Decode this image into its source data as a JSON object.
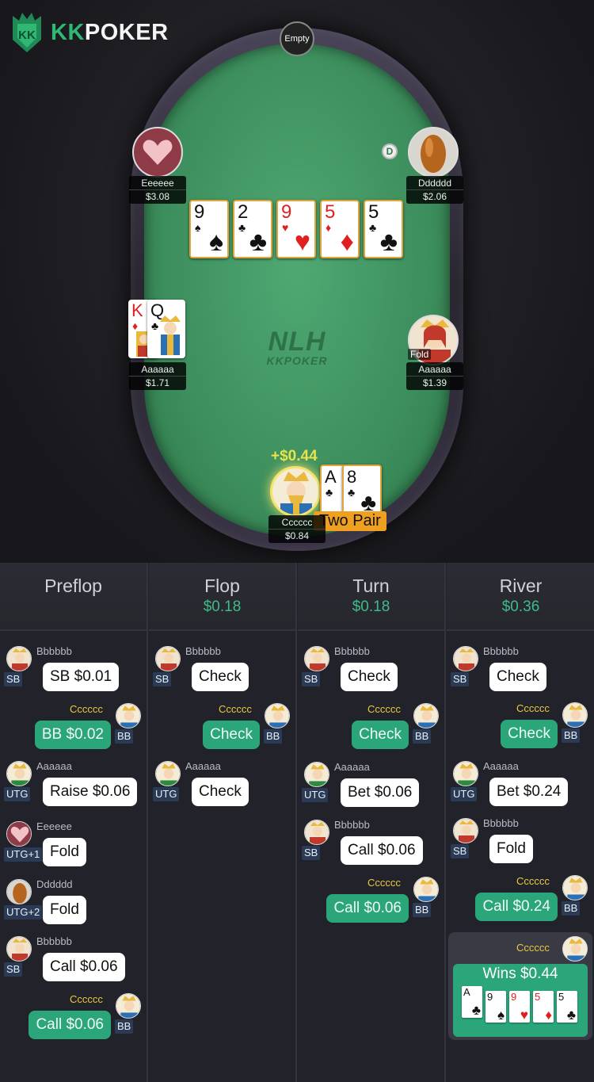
{
  "brand": {
    "kk": "KK",
    "poker": "POKER"
  },
  "table": {
    "empty_seat": "Empty",
    "dealer_button": "D",
    "watermark_game": "NLH",
    "watermark_brand": "KKPOKER",
    "board": [
      {
        "rank": "9",
        "suit": "♠",
        "color": "black"
      },
      {
        "rank": "2",
        "suit": "♣",
        "color": "black"
      },
      {
        "rank": "9",
        "suit": "♥",
        "color": "red"
      },
      {
        "rank": "5",
        "suit": "♦",
        "color": "red"
      },
      {
        "rank": "5",
        "suit": "♣",
        "color": "black"
      }
    ],
    "seats": {
      "top_left": {
        "name": "Eeeeee",
        "stack": "$3.08"
      },
      "top_right": {
        "name": "Dddddd",
        "stack": "$2.06"
      },
      "mid_left": {
        "name": "Aaaaaa",
        "stack": "$1.71",
        "cards": [
          "K♦",
          "Q♣"
        ]
      },
      "mid_right": {
        "name": "Aaaaaa",
        "stack": "$1.39",
        "status": "Fold"
      },
      "hero": {
        "name": "Cccccc",
        "stack": "$0.84",
        "win": "+$0.44",
        "hand": "Two Pair",
        "cards": [
          "A♣",
          "8♣"
        ]
      }
    }
  },
  "history": {
    "columns": [
      {
        "title": "Preflop",
        "pot": ""
      },
      {
        "title": "Flop",
        "pot": "$0.18"
      },
      {
        "title": "Turn",
        "pot": "$0.18"
      },
      {
        "title": "River",
        "pot": "$0.36"
      }
    ],
    "preflop": [
      {
        "name": "Bbbbbb",
        "pos": "SB",
        "action": "SB $0.01"
      },
      {
        "name": "Cccccc",
        "pos": "BB",
        "action": "BB $0.02"
      },
      {
        "name": "Aaaaaa",
        "pos": "UTG",
        "action": "Raise $0.06"
      },
      {
        "name": "Eeeeee",
        "pos": "UTG+1",
        "action": "Fold"
      },
      {
        "name": "Dddddd",
        "pos": "UTG+2",
        "action": "Fold"
      },
      {
        "name": "Bbbbbb",
        "pos": "SB",
        "action": "Call $0.06"
      },
      {
        "name": "Cccccc",
        "pos": "BB",
        "action": "Call $0.06"
      }
    ],
    "flop": [
      {
        "name": "Bbbbbb",
        "pos": "SB",
        "action": "Check"
      },
      {
        "name": "Cccccc",
        "pos": "BB",
        "action": "Check"
      },
      {
        "name": "Aaaaaa",
        "pos": "UTG",
        "action": "Check"
      }
    ],
    "turn": [
      {
        "name": "Bbbbbb",
        "pos": "SB",
        "action": "Check"
      },
      {
        "name": "Cccccc",
        "pos": "BB",
        "action": "Check"
      },
      {
        "name": "Aaaaaa",
        "pos": "UTG",
        "action": "Bet $0.06"
      },
      {
        "name": "Bbbbbb",
        "pos": "SB",
        "action": "Call $0.06"
      },
      {
        "name": "Cccccc",
        "pos": "BB",
        "action": "Call $0.06"
      }
    ],
    "river": [
      {
        "name": "Bbbbbb",
        "pos": "SB",
        "action": "Check"
      },
      {
        "name": "Cccccc",
        "pos": "BB",
        "action": "Check"
      },
      {
        "name": "Aaaaaa",
        "pos": "UTG",
        "action": "Bet $0.24"
      },
      {
        "name": "Bbbbbb",
        "pos": "SB",
        "action": "Fold"
      },
      {
        "name": "Cccccc",
        "pos": "BB",
        "action": "Call $0.24"
      }
    ],
    "result": {
      "name": "Cccccc",
      "text": "Wins $0.44",
      "cards": [
        "A♣",
        "9♠",
        "9♥",
        "5♦",
        "5♣"
      ]
    }
  }
}
